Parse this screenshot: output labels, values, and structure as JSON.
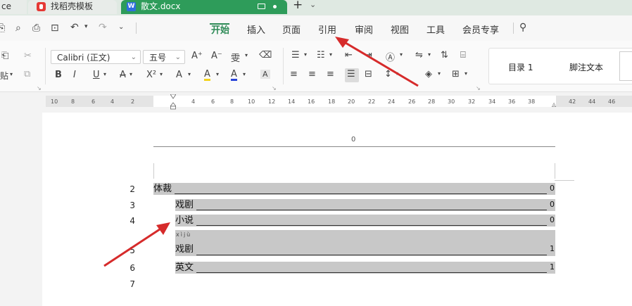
{
  "tabs": {
    "partial": "ce",
    "template": "找稻壳模板",
    "document": "散文.docx",
    "new_tab": "+",
    "menu_chevron": "⌄"
  },
  "quick_access_icons": [
    "save-icon",
    "export-icon",
    "print-icon",
    "print-preview-icon",
    "undo-icon",
    "redo-icon",
    "more-icon"
  ],
  "menu": {
    "items": [
      "开始",
      "插入",
      "页面",
      "引用",
      "审阅",
      "视图",
      "工具",
      "会员专享"
    ],
    "active": "开始",
    "search_icon": "search-icon"
  },
  "ribbon": {
    "paste": "贴",
    "font_name": "Calibri (正文)",
    "font_size": "五号",
    "grow_font": "A⁺",
    "shrink_font": "A⁻",
    "phonetic": "雯",
    "bold": "B",
    "italic": "I",
    "underline": "U",
    "strikethrough": "A",
    "superscript": "X²",
    "text_effect": "A",
    "highlight": "A",
    "font_color": "A",
    "char_border": "A",
    "styles": [
      "目录 1",
      "脚注文本"
    ]
  },
  "ruler": {
    "left": [
      "10",
      "8",
      "6",
      "4",
      "2"
    ],
    "right": [
      "2",
      "4",
      "6",
      "8",
      "10",
      "12",
      "14",
      "16",
      "18",
      "20",
      "22",
      "24",
      "26",
      "28",
      "30",
      "32",
      "34",
      "36",
      "38",
      "42",
      "44",
      "46"
    ]
  },
  "document": {
    "header_page_num": "0",
    "pinyin": "xìjù",
    "line_numbers": [
      "2",
      "3",
      "4",
      "5",
      "6",
      "7"
    ],
    "toc": [
      {
        "text": "体裁",
        "page": "0"
      },
      {
        "text": "戏剧",
        "page": "0"
      },
      {
        "text": "小说",
        "page": "0"
      },
      {
        "text": "戏剧",
        "page": "1"
      },
      {
        "text": "英文",
        "page": "1"
      }
    ]
  },
  "colors": {
    "accent_green": "#2e8b57",
    "doc_tab": "#2e9c5a",
    "arrow_red": "#d62b2b",
    "toc_highlight": "#c8c8c8"
  }
}
